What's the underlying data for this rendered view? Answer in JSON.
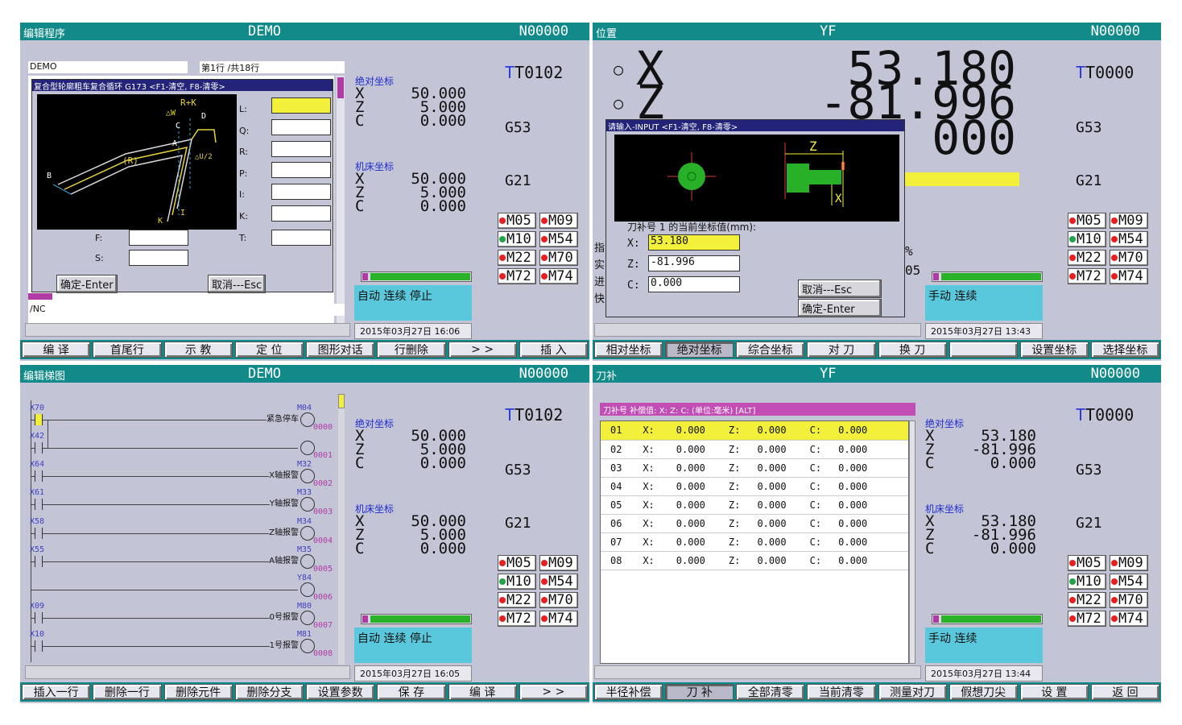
{
  "p1": {
    "title": "编辑程序",
    "program": "DEMO",
    "block": "N00000",
    "file": "DEMO",
    "line": "第1行  /共18行",
    "dialog_title": "复合型轮廓粗车复合循环 G173 <F1-清空, F8-清零>",
    "params": [
      "L:",
      "Q:",
      "R:",
      "P:",
      "I:",
      "K:",
      "T:"
    ],
    "f_label": "F:",
    "s_label": "S:",
    "ok": "确定-Enter",
    "cancel": "取消---Esc",
    "path": "/NC",
    "fig_labels": {
      "rk": "R+K",
      "w": "△W",
      "c": "C",
      "d": "D",
      "r": "(R)",
      "a": "A",
      "u": "△U/2",
      "b": "B",
      "k": "K",
      "i": "I"
    },
    "tool": "T0102",
    "g1": "G53",
    "g2": "G21",
    "abs_label": "绝对坐标",
    "abs": {
      "X": "50.000",
      "Z": "5.000",
      "C": "0.000"
    },
    "mach_label": "机床坐标",
    "mach": {
      "X": "50.000",
      "Z": "5.000",
      "C": "0.000"
    },
    "status": "自动 连续 停止",
    "time": "2015年03月27日 16:06",
    "fkeys": [
      "编  译",
      "首尾行",
      "示  教",
      "定  位",
      "图形对话",
      "行删除",
      "> >",
      "插  入"
    ]
  },
  "p2": {
    "title": "位置",
    "program": "YF",
    "block": "N00000",
    "bigX": "53.180",
    "bigZ": "-81.996",
    "bigC": "000",
    "dialog_title": "请输入-INPUT  <F1-清空, F8-清零>",
    "fig_z": "Z",
    "fig_x": "X",
    "prompt": "刀补号  1  的当前坐标值(mm):",
    "x_label": "X:",
    "z_label": "Z:",
    "c_label": "C:",
    "x_val": "53.180",
    "z_val": "-81.996",
    "c_val": "0.000",
    "cancel": "取消---Esc",
    "ok": "确定-Enter",
    "side_frag": [
      "指",
      "实",
      "进",
      "快"
    ],
    "pct": "%",
    "val05": "05",
    "tool": "T0000",
    "g1": "G53",
    "g2": "G21",
    "status": "手动 连续",
    "time": "2015年03月27日 13:43",
    "fkeys": [
      "相对坐标",
      "绝对坐标",
      "综合坐标",
      "对  刀",
      "换  刀",
      "",
      "设置坐标",
      "选择坐标"
    ]
  },
  "p3": {
    "title": "编辑梯图",
    "program": "DEMO",
    "block": "N00000",
    "rungs": [
      {
        "in": "X70",
        "coil": "M04",
        "name": "紧急停车",
        "num": "0000"
      },
      {
        "in": "X42",
        "coil": "",
        "name": "",
        "num": "0001"
      },
      {
        "in": "X64",
        "coil": "M32",
        "name": "X轴报警",
        "num": "0002"
      },
      {
        "in": "X61",
        "coil": "M33",
        "name": "Y轴报警",
        "num": "0003"
      },
      {
        "in": "X58",
        "coil": "M34",
        "name": "Z轴报警",
        "num": "0004"
      },
      {
        "in": "X55",
        "coil": "M35",
        "name": "A轴报警",
        "num": "0005"
      },
      {
        "in": "",
        "coil": "Y84",
        "name": "",
        "num": "0006"
      },
      {
        "in": "X09",
        "coil": "M80",
        "name": "0号报警",
        "num": "0007"
      },
      {
        "in": "X10",
        "coil": "M81",
        "name": "1号报警",
        "num": "0008"
      }
    ],
    "tool": "T0102",
    "g1": "G53",
    "g2": "G21",
    "abs_label": "绝对坐标",
    "abs": {
      "X": "50.000",
      "Z": "5.000",
      "C": "0.000"
    },
    "mach_label": "机床坐标",
    "mach": {
      "X": "50.000",
      "Z": "5.000",
      "C": "0.000"
    },
    "status": "自动 连续 停止",
    "time": "2015年03月27日 16:05",
    "fkeys": [
      "插入一行",
      "删除一行",
      "删除元件",
      "删除分支",
      "设置参数",
      "保  存",
      "编  译",
      "> >"
    ]
  },
  "p4": {
    "title": "刀补",
    "program": "YF",
    "block": "N00000",
    "header": "刀补号    补偿值: X: Z: C: (单位:毫米) [ALT]",
    "rows": [
      [
        "01",
        "X:",
        "0.000",
        "Z:",
        "0.000",
        "C:",
        "0.000"
      ],
      [
        "02",
        "X:",
        "0.000",
        "Z:",
        "0.000",
        "C:",
        "0.000"
      ],
      [
        "03",
        "X:",
        "0.000",
        "Z:",
        "0.000",
        "C:",
        "0.000"
      ],
      [
        "04",
        "X:",
        "0.000",
        "Z:",
        "0.000",
        "C:",
        "0.000"
      ],
      [
        "05",
        "X:",
        "0.000",
        "Z:",
        "0.000",
        "C:",
        "0.000"
      ],
      [
        "06",
        "X:",
        "0.000",
        "Z:",
        "0.000",
        "C:",
        "0.000"
      ],
      [
        "07",
        "X:",
        "0.000",
        "Z:",
        "0.000",
        "C:",
        "0.000"
      ],
      [
        "08",
        "X:",
        "0.000",
        "Z:",
        "0.000",
        "C:",
        "0.000"
      ]
    ],
    "tool": "T0000",
    "g1": "G53",
    "g2": "G21",
    "abs_label": "绝对坐标",
    "abs": {
      "X": "53.180",
      "Z": "-81.996",
      "C": "0.000"
    },
    "mach_label": "机床坐标",
    "mach": {
      "X": "53.180",
      "Z": "-81.996",
      "C": "0.000"
    },
    "status": "手动 连续",
    "time": "2015年03月27日 13:44",
    "fkeys": [
      "半径补偿",
      "刀  补",
      "全部清零",
      "当前清零",
      "测量对刀",
      "假想刀尖",
      "设  置",
      "返  回"
    ]
  },
  "mcodes": [
    "M05",
    "M09",
    "M10",
    "M54",
    "M22",
    "M70",
    "M72",
    "M74"
  ],
  "colors": {
    "panel": "#c3c5d6",
    "titlebar": "#128a8a",
    "status": "#5ac8dc",
    "highlight": "#f2f03a",
    "tool_letter": "#2a3bd6"
  }
}
